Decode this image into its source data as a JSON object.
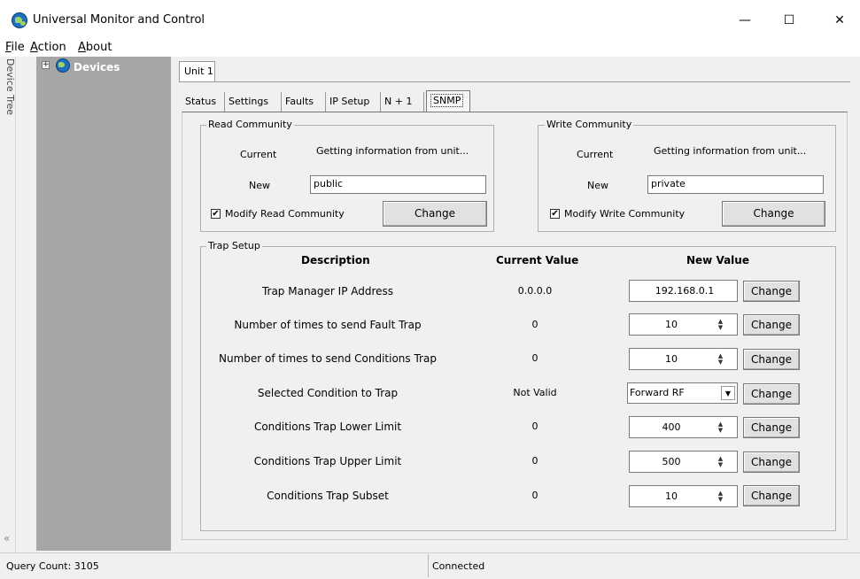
{
  "window": {
    "title": "Universal Monitor and Control",
    "minimize": "—",
    "maximize": "☐",
    "close": "✕"
  },
  "menu": [
    {
      "underline": "F",
      "rest": "ile"
    },
    {
      "underline": "A",
      "rest": "ction"
    },
    {
      "underline": "A",
      "rest": "bout"
    }
  ],
  "side": {
    "label": "Device Tree",
    "collapse": "«",
    "tree_root": "Devices",
    "expander": "⊞"
  },
  "unit_tab": "Unit 1",
  "tabs": [
    "Status",
    "Settings",
    "Faults",
    "IP Setup",
    "N + 1",
    "SNMP"
  ],
  "read_community": {
    "legend": "Read Community",
    "current_label": "Current",
    "current_value": "Getting information from unit...",
    "new_label": "New",
    "new_value": "public",
    "checkbox_label": "Modify Read Community",
    "checked": true,
    "button": "Change"
  },
  "write_community": {
    "legend": "Write Community",
    "current_label": "Current",
    "current_value": "Getting information from unit...",
    "new_label": "New",
    "new_value": "private",
    "checkbox_label": "Modify Write Community",
    "checked": true,
    "button": "Change"
  },
  "trap": {
    "legend": "Trap Setup",
    "headers": {
      "description": "Description",
      "current": "Current Value",
      "new": "New Value"
    },
    "rows": [
      {
        "description": "Trap Manager IP Address",
        "current": "0.0.0.0",
        "new": "192.168.0.1",
        "control": "text",
        "button": "Change"
      },
      {
        "description": "Number of times to send Fault Trap",
        "current": "0",
        "new": "10",
        "control": "spin",
        "button": "Change"
      },
      {
        "description": "Number of times to send Conditions Trap",
        "current": "0",
        "new": "10",
        "control": "spin",
        "button": "Change"
      },
      {
        "description": "Selected Condition to Trap",
        "current": "Not Valid",
        "new": "Forward RF",
        "control": "dropdown",
        "button": "Change"
      },
      {
        "description": "Conditions Trap Lower Limit",
        "current": "0",
        "new": "400",
        "control": "spin",
        "button": "Change"
      },
      {
        "description": "Conditions Trap Upper Limit",
        "current": "0",
        "new": "500",
        "control": "spin",
        "button": "Change"
      },
      {
        "description": "Conditions Trap Subset",
        "current": "0",
        "new": "10",
        "control": "spin",
        "button": "Change"
      }
    ]
  },
  "status": {
    "query_count": "Query Count: 3105",
    "connection": "Connected"
  },
  "icons": {
    "app": "globe-icon",
    "check": "✔",
    "spin_up": "▲",
    "spin_down": "▼",
    "dropdown": "▼"
  },
  "colors": {
    "tree_bg": "#a6a6a6",
    "window_bg": "#f0f0f0"
  }
}
